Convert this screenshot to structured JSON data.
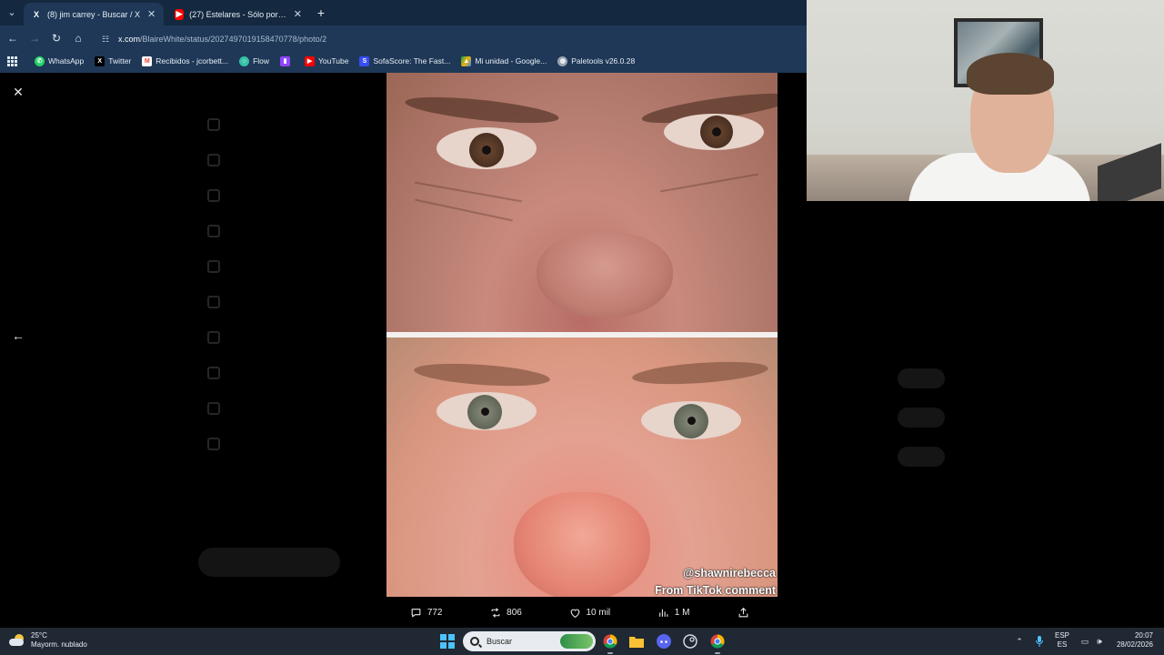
{
  "browser": {
    "tabs": [
      {
        "label": "(8) jim carrey - Buscar / X",
        "favicon": "x-logo-icon",
        "active": true
      },
      {
        "label": "(27) Estelares - Sólo por hoy (C",
        "favicon": "youtube-icon",
        "active": false
      }
    ],
    "new_tab": "+",
    "address": {
      "host": "x.com",
      "path": "/BlaireWhite/status/2027497019158470778/photo/2"
    },
    "bookmarks": [
      {
        "label": "WhatsApp",
        "icon": "whatsapp-icon",
        "color": "#25d366"
      },
      {
        "label": "Twitter",
        "icon": "x-logo-icon",
        "color": "#000000"
      },
      {
        "label": "Recibidos - jcorbett...",
        "icon": "gmail-icon",
        "color": "#ea4335"
      },
      {
        "label": "Flow",
        "icon": "flow-icon",
        "color": "#35c2a6"
      },
      {
        "label": "",
        "icon": "twitch-icon",
        "color": "#9146ff"
      },
      {
        "label": "YouTube",
        "icon": "youtube-icon",
        "color": "#ff0000"
      },
      {
        "label": "SofaScore: The Fast...",
        "icon": "sofascore-icon",
        "color": "#374df5"
      },
      {
        "label": "Mi unidad - Google...",
        "icon": "google-drive-icon",
        "color": "#f4b400"
      },
      {
        "label": "Paletools v26.0.28",
        "icon": "globe-icon",
        "color": "#9aa5b1"
      }
    ]
  },
  "media": {
    "watermark_user": "@shawnirebecca",
    "watermark_caption": "From TikTok comment"
  },
  "actions": {
    "replies": "772",
    "reposts": "806",
    "likes": "10 mil",
    "views": "1 M"
  },
  "taskbar": {
    "weather_temp": "25°C",
    "weather_desc": "Mayorm. nublado",
    "search_placeholder": "Buscar",
    "lang_top": "ESP",
    "lang_bottom": "ES",
    "time": "20:07",
    "date": "28/02/2026"
  },
  "colors": {
    "accent": "#1d9bf0",
    "chrome": "#1f3857",
    "taskbar": "#202833"
  }
}
